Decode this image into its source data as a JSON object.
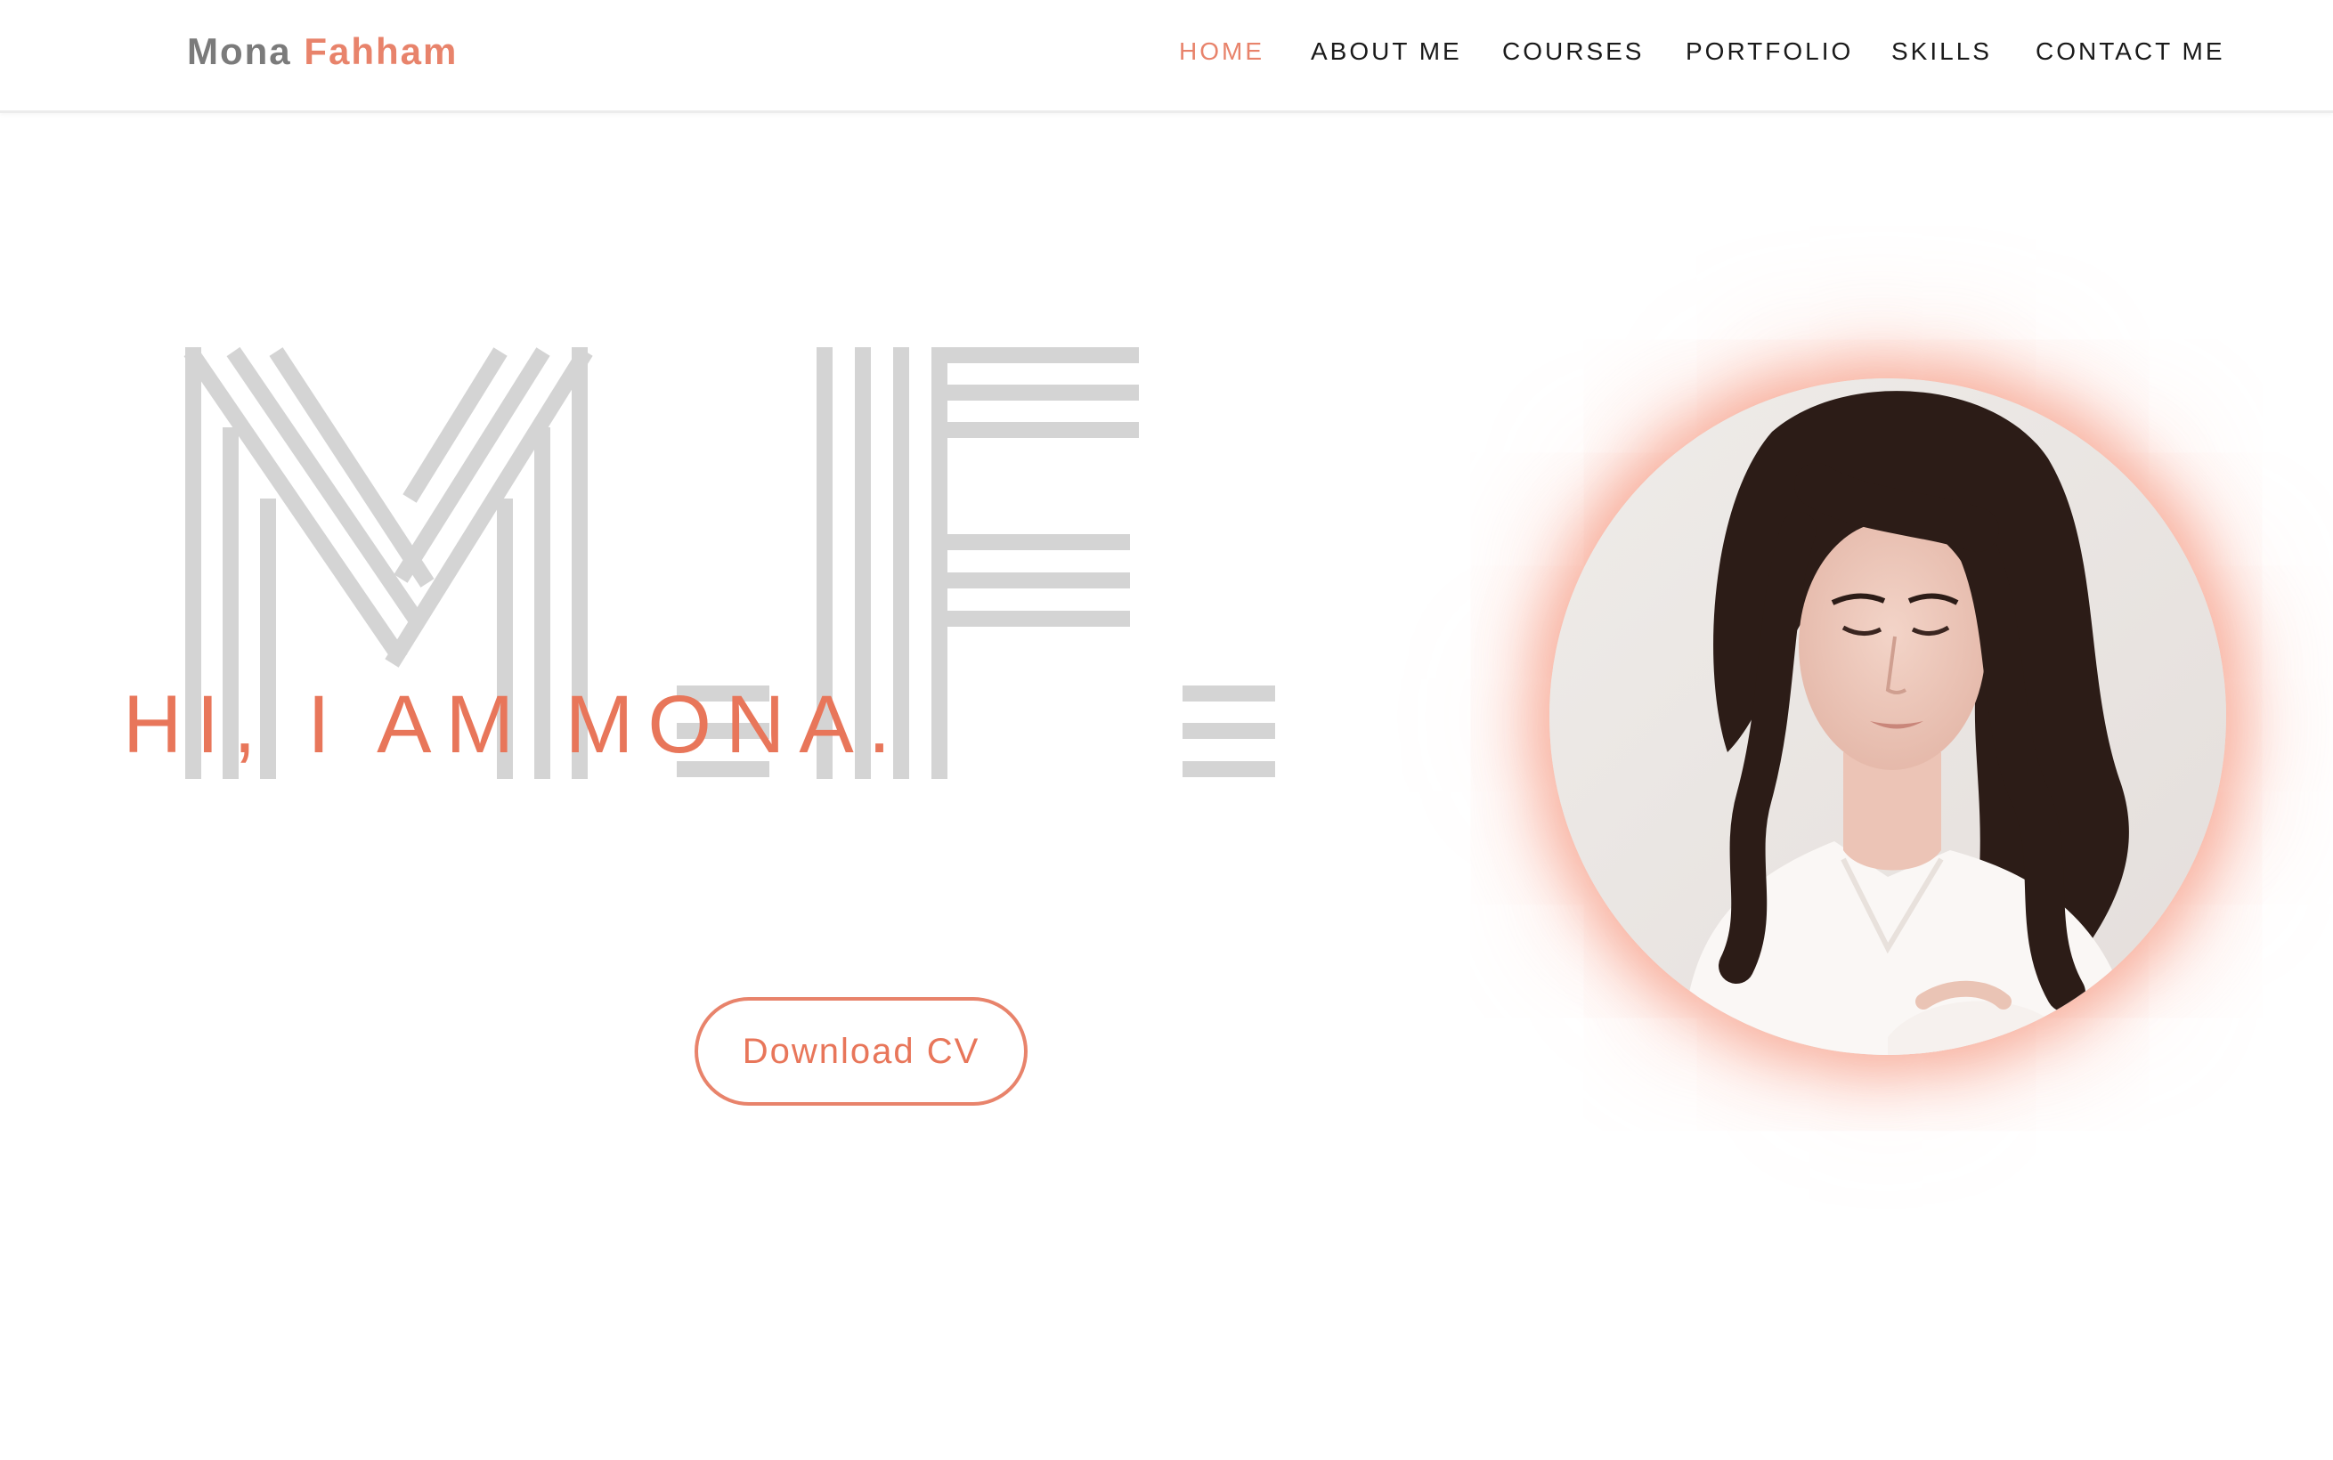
{
  "header": {
    "logo_first": "Mona",
    "logo_last": "Fahham",
    "nav": [
      {
        "label": "HOME",
        "active": true
      },
      {
        "label": "ABOUT ME",
        "active": false
      },
      {
        "label": "COURSES",
        "active": false
      },
      {
        "label": "PORTFOLIO",
        "active": false
      },
      {
        "label": "SKILLS",
        "active": false
      },
      {
        "label": "CONTACT ME",
        "active": false
      }
    ]
  },
  "hero": {
    "monogram": "M.F.",
    "greeting": "HI, I AM MONA.",
    "cv_button": "Download CV"
  },
  "colors": {
    "accent": "#e8836b",
    "logo_grey": "#7b7b7b",
    "monogram_grey": "#d4d4d4",
    "nav_text": "#1a1a1a"
  },
  "icons": {
    "portrait": "woman-portrait-photo"
  }
}
